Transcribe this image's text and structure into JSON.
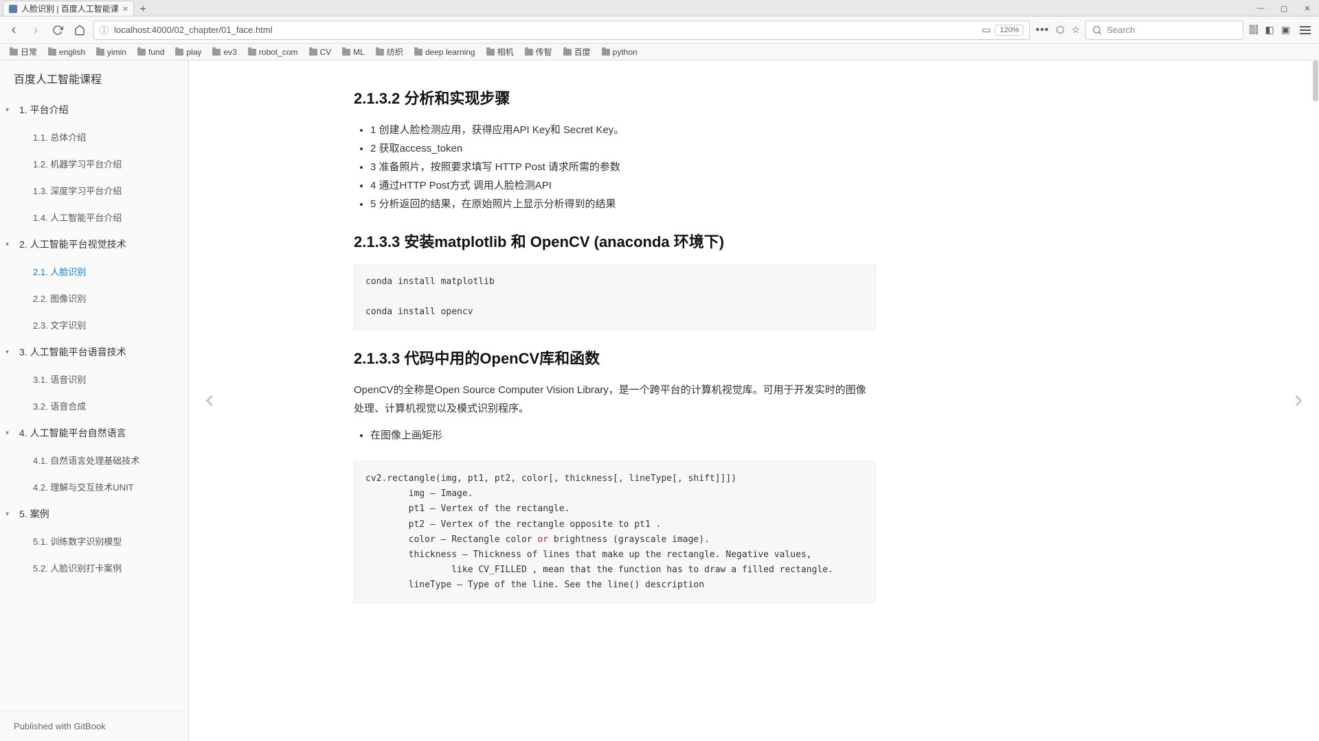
{
  "browser": {
    "tab_title": "人脸识别 | 百度人工智能课",
    "new_tab": "+",
    "url": "localhost:4000/02_chapter/01_face.html",
    "zoom": "120%",
    "search_placeholder": "Search",
    "bookmarks": [
      "日常",
      "english",
      "yimin",
      "fund",
      "play",
      "ev3",
      "robot_com",
      "CV",
      "ML",
      "纺织",
      "deep learning",
      "相机",
      "传智",
      "百度",
      "python"
    ]
  },
  "sidebar": {
    "title": "百度人工智能课程",
    "footer": "Published with GitBook",
    "sections": [
      {
        "num": "1.",
        "title": "平台介绍",
        "items": [
          {
            "num": "1.1.",
            "title": "总体介绍"
          },
          {
            "num": "1.2.",
            "title": "机器学习平台介绍"
          },
          {
            "num": "1.3.",
            "title": "深度学习平台介绍"
          },
          {
            "num": "1.4.",
            "title": "人工智能平台介绍"
          }
        ]
      },
      {
        "num": "2.",
        "title": "人工智能平台视觉技术",
        "items": [
          {
            "num": "2.1.",
            "title": "人脸识别",
            "active": true
          },
          {
            "num": "2.2.",
            "title": "图像识别"
          },
          {
            "num": "2.3.",
            "title": "文字识别"
          }
        ]
      },
      {
        "num": "3.",
        "title": "人工智能平台语音技术",
        "items": [
          {
            "num": "3.1.",
            "title": "语音识别"
          },
          {
            "num": "3.2.",
            "title": "语音合成"
          }
        ]
      },
      {
        "num": "4.",
        "title": "人工智能平台自然语言",
        "items": [
          {
            "num": "4.1.",
            "title": "自然语言处理基础技术"
          },
          {
            "num": "4.2.",
            "title": "理解与交互技术UNIT"
          }
        ]
      },
      {
        "num": "5.",
        "title": "案例",
        "items": [
          {
            "num": "5.1.",
            "title": "训练数字识别模型"
          },
          {
            "num": "5.2.",
            "title": "人脸识别打卡案例"
          }
        ]
      }
    ]
  },
  "content": {
    "h1": "2.1.3.2 分析和实现步骤",
    "steps": [
      "1 创建人脸检测应用，获得应用API Key和 Secret Key。",
      "2 获取access_token",
      "3 准备照片，按照要求填写 HTTP Post 请求所需的参数",
      "4 通过HTTP Post方式 调用人脸检测API",
      "5 分析返回的结果，在原始照片上显示分析得到的结果"
    ],
    "h2": "2.1.3.3 安装matplotlib 和 OpenCV (anaconda 环境下)",
    "code1": "conda install matplotlib\n\nconda install opencv",
    "h3": "2.1.3.3 代码中用的OpenCV库和函数",
    "para1": "OpenCV的全称是Open Source Computer Vision Library，是一个跨平台的计算机视觉库。可用于开发实时的图像处理、计算机视觉以及模式识别程序。",
    "bullet1": "在图像上画矩形",
    "code2_pre": "cv2.rectangle(img, pt1, pt2, color[, thickness[, lineType[, shift]]])\n        img – Image.\n        pt1 – Vertex of the rectangle.\n        pt2 – Vertex of the rectangle opposite to pt1 .\n        color – Rectangle color ",
    "code2_kw": "or",
    "code2_post": " brightness (grayscale image).\n        thickness – Thickness of lines that make up the rectangle. Negative values,\n                like CV_FILLED , mean that the function has to draw a filled rectangle.\n        lineType – Type of the line. See the line() description"
  }
}
